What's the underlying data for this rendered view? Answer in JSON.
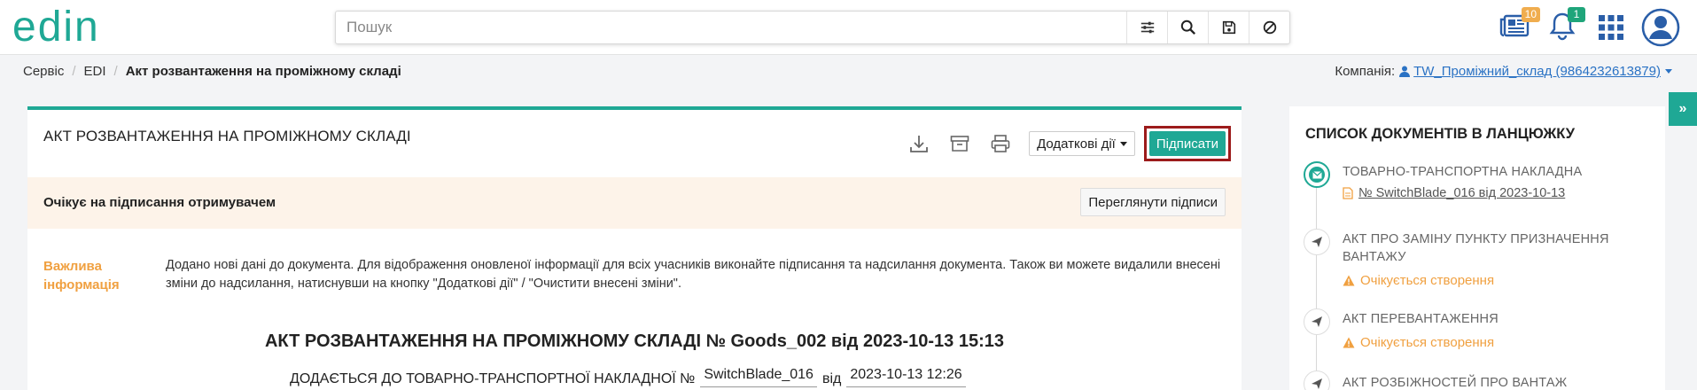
{
  "app": {
    "logo_text": "edin"
  },
  "search": {
    "placeholder": "Пошук",
    "value": ""
  },
  "topbar": {
    "docs_badge": "10",
    "notifications_badge": "1"
  },
  "breadcrumb": {
    "items": [
      "Сервіс",
      "EDI"
    ],
    "current": "Акт розвантаження на проміжному складі"
  },
  "company": {
    "label": "Компанія:",
    "value": "TW_Проміжний_склад (9864232613879)"
  },
  "document": {
    "title": "АКТ РОЗВАНТАЖЕННЯ НА ПРОМІЖНОМУ СКЛАДІ",
    "more_actions_label": "Додаткові дії",
    "sign_label": "Підписати",
    "status_text": "Очікує на підписання отримувачем",
    "view_signatures_label": "Переглянути підписи",
    "info_label": "Важлива інформація",
    "info_text": "Додано нові дані до документа. Для відображення оновленої інформації для всіх учасників виконайте підписання та надсилання документа. Також ви можете видалили внесені зміни до надсилання, натиснувши на кнопку \"Додаткові дії\" / \"Очистити внесені зміни\".",
    "heading": "АКТ РОЗВАНТАЖЕННЯ НА ПРОМІЖНОМУ СКЛАДІ № Goods_002 від 2023-10-13 15:13",
    "sub_prefix": "ДОДАЄТЬСЯ ДО ТОВАРНО-ТРАНСПОРТНОЇ НАКЛАДНОЇ №",
    "sub_number": "SwitchBlade_016",
    "sub_from": "від",
    "sub_date": "2023-10-13 12:26"
  },
  "chain": {
    "title": "СПИСОК ДОКУМЕНТІВ В ЛАНЦЮЖКУ",
    "items": [
      {
        "title": "ТОВАРНО-ТРАНСПОРТНА НАКЛАДНА",
        "link": " № SwitchBlade_016 від 2023-10-13"
      },
      {
        "title": "АКТ ПРО ЗАМІНУ ПУНКТУ ПРИЗНАЧЕННЯ ВАНТАЖУ",
        "status": "Очікується створення"
      },
      {
        "title": "АКТ ПЕРЕВАНТАЖЕННЯ",
        "status": "Очікується створення"
      },
      {
        "title": "АКТ РОЗБІЖНОСТЕЙ ПРО ВАНТАЖ"
      }
    ]
  },
  "colors": {
    "accent": "#1fa895",
    "warning": "#f0a040",
    "highlight_border": "#9c1b1b",
    "status_bg": "#fdf3e9"
  }
}
